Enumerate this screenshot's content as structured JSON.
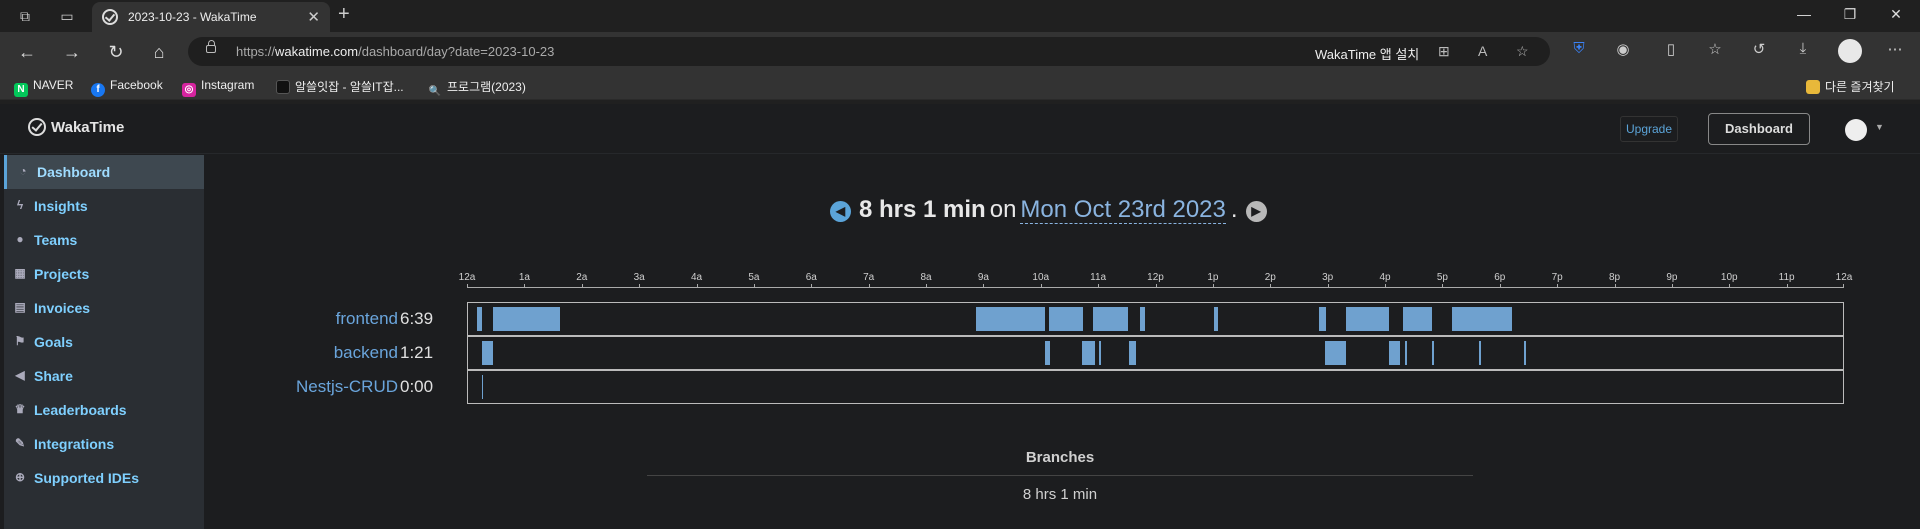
{
  "browser": {
    "tab_title": "2023-10-23 - WakaTime",
    "url_prefix": "https://",
    "url_host": "wakatime.com",
    "url_path": "/dashboard/day?date=2023-10-23",
    "install_prompt": "WakaTime 앱 설치",
    "bookmarks": [
      {
        "label": "NAVER",
        "icon": "naver-icon",
        "color": "#03c75a"
      },
      {
        "label": "Facebook",
        "icon": "facebook-icon",
        "color": "#1877f2"
      },
      {
        "label": "Instagram",
        "icon": "instagram-icon",
        "color": "#d6249f"
      },
      {
        "label": "알쓸잇잡 - 알쓸IT잡...",
        "icon": "site-icon",
        "color": "#111111"
      },
      {
        "label": "프로그램(2023)",
        "icon": "search-icon",
        "color": "#333333"
      }
    ],
    "other_favorites": "다른 즐겨찾기"
  },
  "topnav": {
    "brand": "WakaTime",
    "upgrade": "Upgrade",
    "dashboard": "Dashboard"
  },
  "sidebar": {
    "items": [
      {
        "label": "Dashboard",
        "icon": "dashboard-icon",
        "active": true
      },
      {
        "label": "Insights",
        "icon": "bolt-icon"
      },
      {
        "label": "Teams",
        "icon": "users-icon"
      },
      {
        "label": "Projects",
        "icon": "grid-icon"
      },
      {
        "label": "Invoices",
        "icon": "file-icon"
      },
      {
        "label": "Goals",
        "icon": "flag-icon"
      },
      {
        "label": "Share",
        "icon": "share-icon"
      },
      {
        "label": "Leaderboards",
        "icon": "trophy-icon"
      },
      {
        "label": "Integrations",
        "icon": "wrench-icon"
      },
      {
        "label": "Supported IDEs",
        "icon": "plus-circle-icon"
      }
    ]
  },
  "headline": {
    "total": "8 hrs 1 min",
    "on": "on",
    "date": "Mon Oct 23rd 2023",
    "dot": "."
  },
  "colors": {
    "accent": "#5ba4d9",
    "bar": "#6fa1cf",
    "arrow_prev": "#5ba4d9",
    "arrow_next": "#b8b8b8"
  },
  "chart_data": {
    "type": "bar",
    "x_unit": "hour of day",
    "xlim": [
      0,
      24
    ],
    "tick_labels": [
      "12a",
      "1a",
      "2a",
      "3a",
      "4a",
      "5a",
      "6a",
      "7a",
      "8a",
      "9a",
      "10a",
      "11a",
      "12p",
      "1p",
      "2p",
      "3p",
      "4p",
      "5p",
      "6p",
      "7p",
      "8p",
      "9p",
      "10p",
      "11p",
      "12a"
    ],
    "series": [
      {
        "name": "frontend",
        "time": "6:39",
        "segments": [
          [
            0.16,
            0.24
          ],
          [
            0.43,
            1.6
          ],
          [
            8.86,
            10.05
          ],
          [
            10.12,
            10.72
          ],
          [
            10.9,
            11.5
          ],
          [
            11.72,
            11.8
          ],
          [
            13.0,
            13.08
          ],
          [
            14.83,
            14.95
          ],
          [
            15.3,
            16.05
          ],
          [
            16.3,
            16.8
          ],
          [
            17.15,
            18.2
          ]
        ]
      },
      {
        "name": "backend",
        "time": "1:21",
        "segments": [
          [
            0.25,
            0.43
          ],
          [
            10.05,
            10.14
          ],
          [
            10.7,
            10.93
          ],
          [
            11.0,
            11.04
          ],
          [
            11.52,
            11.65
          ],
          [
            14.93,
            15.3
          ],
          [
            16.05,
            16.25
          ],
          [
            16.33,
            16.37
          ],
          [
            16.8,
            16.84
          ],
          [
            17.62,
            17.66
          ],
          [
            18.4,
            18.44
          ]
        ]
      },
      {
        "name": "Nestjs-CRUD",
        "time": "0:00",
        "segments": [
          [
            0.24,
            0.26
          ]
        ]
      }
    ]
  },
  "branches": {
    "title": "Branches",
    "total": "8 hrs 1 min"
  }
}
